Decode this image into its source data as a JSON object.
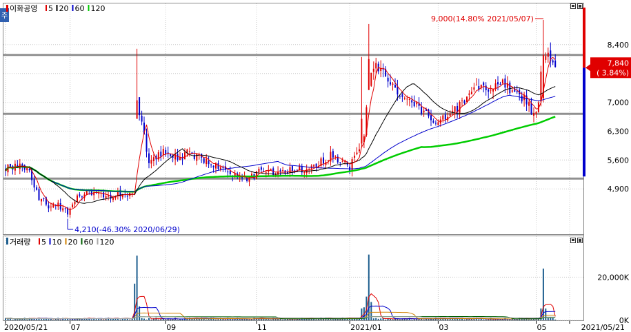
{
  "header": {
    "price_title": "이화공영",
    "price_ma_labels": [
      {
        "label": "5",
        "color": "#e00000"
      },
      {
        "label": "20",
        "color": "#000000"
      },
      {
        "label": "60",
        "color": "#0000cc"
      },
      {
        "label": "120",
        "color": "#00cc00"
      }
    ],
    "volume_title": "거래량",
    "volume_ma_labels": [
      {
        "label": "5",
        "color": "#e00000"
      },
      {
        "label": "10",
        "color": "#0000cc"
      },
      {
        "label": "20",
        "color": "#d08000"
      },
      {
        "label": "60",
        "color": "#006000"
      },
      {
        "label": "120",
        "color": "#aaaaaa"
      }
    ],
    "side_tab": "주"
  },
  "colors": {
    "up": "#e00000",
    "down": "#0000cc",
    "ma5": "#e00000",
    "ma20": "#000000",
    "ma60": "#0000cc",
    "ma120": "#00cc00",
    "vol_bar": "#1f5f8f",
    "grid": "#c8c8c8",
    "hline": "#909090",
    "last_price_bg": "#e00000"
  },
  "chart_data": [
    {
      "type": "candlestick",
      "title": "이화공영",
      "y_ticks": [
        4900,
        5600,
        6300,
        7000,
        7700,
        8400
      ],
      "y_tick_labels": [
        "4,900",
        "5,600",
        "6,300",
        "7,000",
        "7,700",
        "8,400"
      ],
      "ylim": [
        3800,
        9400
      ],
      "x_ticks": [
        {
          "label": "2020/05/21",
          "idx": 0
        },
        {
          "label": "07",
          "idx": 27
        },
        {
          "label": "09",
          "idx": 67
        },
        {
          "label": "11",
          "idx": 105
        },
        {
          "label": "2021/01",
          "idx": 144
        },
        {
          "label": "03",
          "idx": 181
        },
        {
          "label": "05",
          "idx": 222
        },
        {
          "label": "2021/05/21",
          "idx": 236
        }
      ],
      "horizontal_lines": [
        8150,
        6720,
        5150
      ],
      "max_annotation": {
        "text": "9,000(14.80% 2021/05/07)",
        "idx": 225,
        "value": 9000
      },
      "min_annotation": {
        "text": "4,210(-46.30% 2020/06/29)",
        "idx": 26,
        "value": 4210
      },
      "last_price": {
        "value": "7,840",
        "change": "( 3.84%)",
        "price": 7840
      },
      "anchors": [
        [
          0,
          5400
        ],
        [
          5,
          5450
        ],
        [
          10,
          5300
        ],
        [
          14,
          4700
        ],
        [
          18,
          4500
        ],
        [
          22,
          4500
        ],
        [
          26,
          4350
        ],
        [
          30,
          4700
        ],
        [
          34,
          4800
        ],
        [
          38,
          4850
        ],
        [
          42,
          4700
        ],
        [
          46,
          4750
        ],
        [
          50,
          4800
        ],
        [
          54,
          4750
        ],
        [
          55,
          7000
        ],
        [
          57,
          6500
        ],
        [
          60,
          5600
        ],
        [
          63,
          5700
        ],
        [
          67,
          5800
        ],
        [
          72,
          5600
        ],
        [
          77,
          5800
        ],
        [
          82,
          5600
        ],
        [
          87,
          5500
        ],
        [
          92,
          5400
        ],
        [
          96,
          5200
        ],
        [
          101,
          5100
        ],
        [
          106,
          5300
        ],
        [
          111,
          5300
        ],
        [
          116,
          5350
        ],
        [
          121,
          5400
        ],
        [
          126,
          5350
        ],
        [
          131,
          5550
        ],
        [
          136,
          5700
        ],
        [
          141,
          5600
        ],
        [
          144,
          5400
        ],
        [
          150,
          6200
        ],
        [
          152,
          7400
        ],
        [
          155,
          8000
        ],
        [
          157,
          7700
        ],
        [
          160,
          7600
        ],
        [
          164,
          7200
        ],
        [
          168,
          7100
        ],
        [
          172,
          6900
        ],
        [
          176,
          6700
        ],
        [
          180,
          6500
        ],
        [
          184,
          6600
        ],
        [
          188,
          6800
        ],
        [
          192,
          7100
        ],
        [
          196,
          7300
        ],
        [
          200,
          7350
        ],
        [
          204,
          7400
        ],
        [
          207,
          7550
        ],
        [
          211,
          7300
        ],
        [
          215,
          7200
        ],
        [
          218,
          7000
        ],
        [
          221,
          6700
        ],
        [
          223,
          7000
        ],
        [
          224,
          7800
        ],
        [
          225,
          8100
        ],
        [
          227,
          8300
        ],
        [
          229,
          7850
        ],
        [
          230,
          7840
        ]
      ],
      "events": [
        {
          "idx": 55,
          "high": 8300,
          "low": 6700,
          "open": 6600,
          "close": 7050
        },
        {
          "idx": 149,
          "high": 8100,
          "low": 5900,
          "open": 6000,
          "close": 6600
        },
        {
          "idx": 152,
          "high": 8900,
          "low": 7300,
          "open": 7300,
          "close": 8050
        },
        {
          "idx": 225,
          "high": 9000,
          "low": 7000,
          "open": 7100,
          "close": 8150
        }
      ]
    },
    {
      "type": "bar",
      "title": "거래량",
      "y_ticks": [
        0,
        20000
      ],
      "y_tick_labels": [
        "0K",
        "20,000K"
      ],
      "ylim": [
        0,
        31000
      ],
      "spikes": [
        {
          "idx": 54,
          "value": 17000
        },
        {
          "idx": 55,
          "value": 30000
        },
        {
          "idx": 56,
          "value": 6500
        },
        {
          "idx": 149,
          "value": 5500
        },
        {
          "idx": 150,
          "value": 6000
        },
        {
          "idx": 151,
          "value": 11000
        },
        {
          "idx": 152,
          "value": 30500
        },
        {
          "idx": 153,
          "value": 8500
        },
        {
          "idx": 224,
          "value": 5500
        },
        {
          "idx": 225,
          "value": 24000
        },
        {
          "idx": 226,
          "value": 5500
        }
      ]
    }
  ]
}
